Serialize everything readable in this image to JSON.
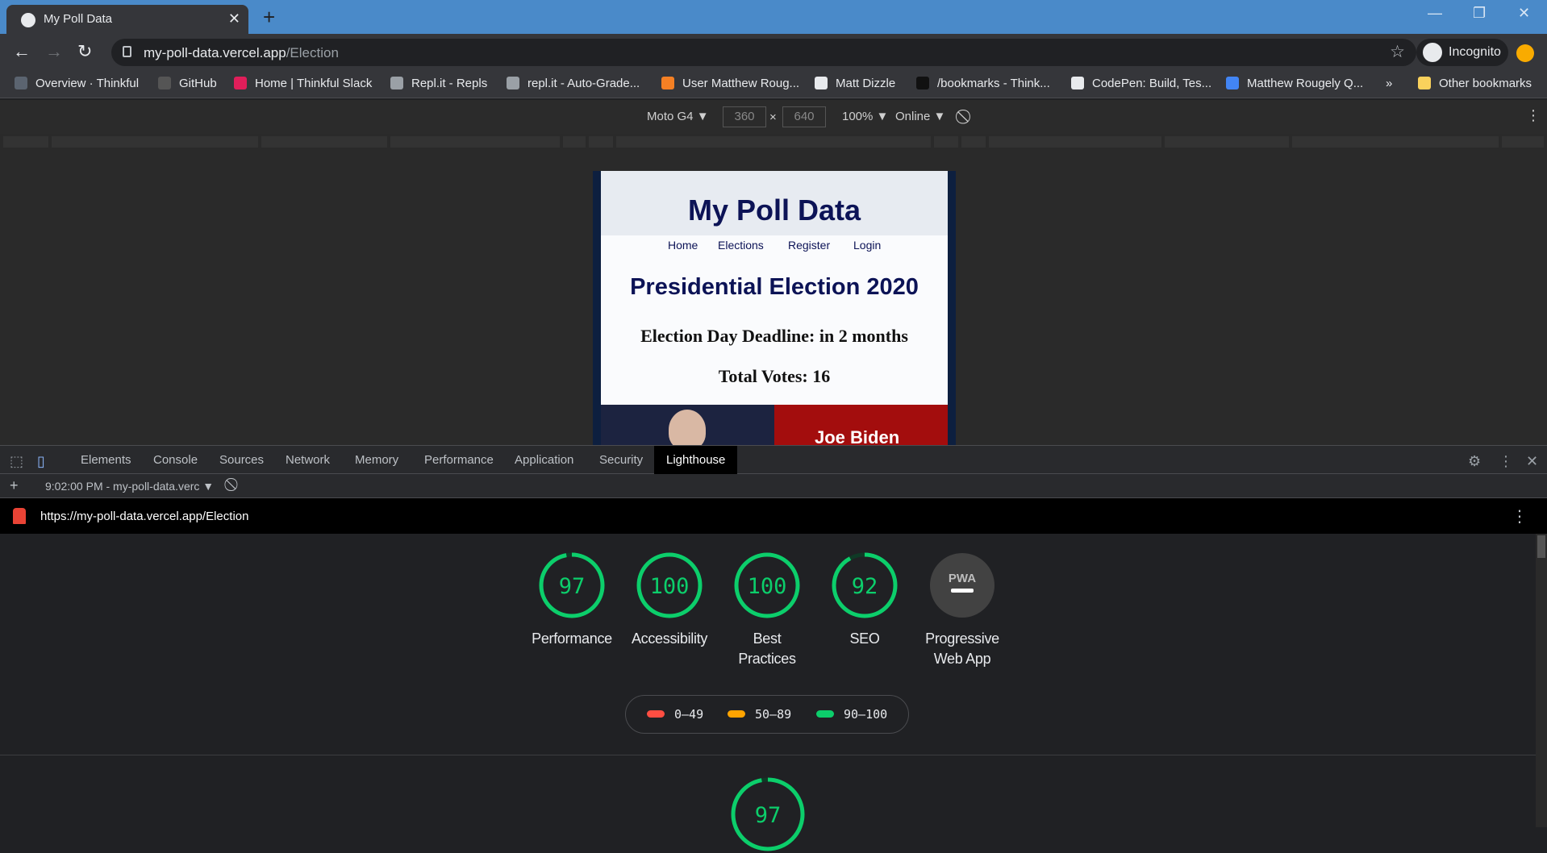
{
  "browser": {
    "tab_title": "My Poll Data",
    "url_host": "my-poll-data.vercel.app",
    "url_path": "/Election",
    "profile_label": "Incognito"
  },
  "bookmarks": [
    {
      "label": "Overview · Thinkful",
      "color": "#5b6470"
    },
    {
      "label": "GitHub",
      "color": "#555555"
    },
    {
      "label": "Home | Thinkful Slack",
      "color": "#e01e5a"
    },
    {
      "label": "Repl.it - Repls",
      "color": "#9aa0a6"
    },
    {
      "label": "repl.it - Auto-Grade...",
      "color": "#9aa0a6"
    },
    {
      "label": "User Matthew Roug...",
      "color": "#f48024"
    },
    {
      "label": "Matt Dizzle",
      "color": "#e8eaed"
    },
    {
      "label": "/bookmarks - Think...",
      "color": "#111111"
    },
    {
      "label": "CodePen: Build, Tes...",
      "color": "#e8eaed"
    },
    {
      "label": "Matthew Rougely Q...",
      "color": "#4285f4"
    },
    {
      "label": "Other bookmarks",
      "color": "#f9d15c"
    }
  ],
  "bookmarks_more": "»",
  "device_toolbar": {
    "device": "Moto G4 ▼",
    "width": "360",
    "height": "640",
    "times": "×",
    "zoom": "100% ▼",
    "network": "Online ▼"
  },
  "site": {
    "brand": "My Poll Data",
    "nav": [
      "Home",
      "Elections",
      "Register",
      "Login"
    ],
    "heading": "Presidential Election 2020",
    "deadline": "Election Day Deadline: in 2 months",
    "total_votes": "Total Votes: 16",
    "candidate": "Joe Biden"
  },
  "devtools": {
    "tabs": [
      "Elements",
      "Console",
      "Sources",
      "Network",
      "Memory",
      "Performance",
      "Application",
      "Security",
      "Lighthouse"
    ],
    "active_tab": "Lighthouse",
    "report_select": "9:02:00 PM - my-poll-data.verc ▼",
    "report_url": "https://my-poll-data.vercel.app/Election"
  },
  "lighthouse": {
    "scores": [
      {
        "label": "Performance",
        "value": 97
      },
      {
        "label": "Accessibility",
        "value": 100
      },
      {
        "label": "Best Practices",
        "value": 100
      },
      {
        "label": "SEO",
        "value": 92
      },
      {
        "label": "Progressive Web App",
        "value": null,
        "badge": "PWA"
      }
    ],
    "legend": [
      {
        "range": "0–49",
        "color": "#ff4e42"
      },
      {
        "range": "50–89",
        "color": "#ffa400"
      },
      {
        "range": "90–100",
        "color": "#0cce6b"
      }
    ],
    "detail_score": 97
  },
  "colors": {
    "pass": "#0cce6b",
    "brand_navy": "#0c1356",
    "chrome_frame": "#4a8ac9"
  }
}
